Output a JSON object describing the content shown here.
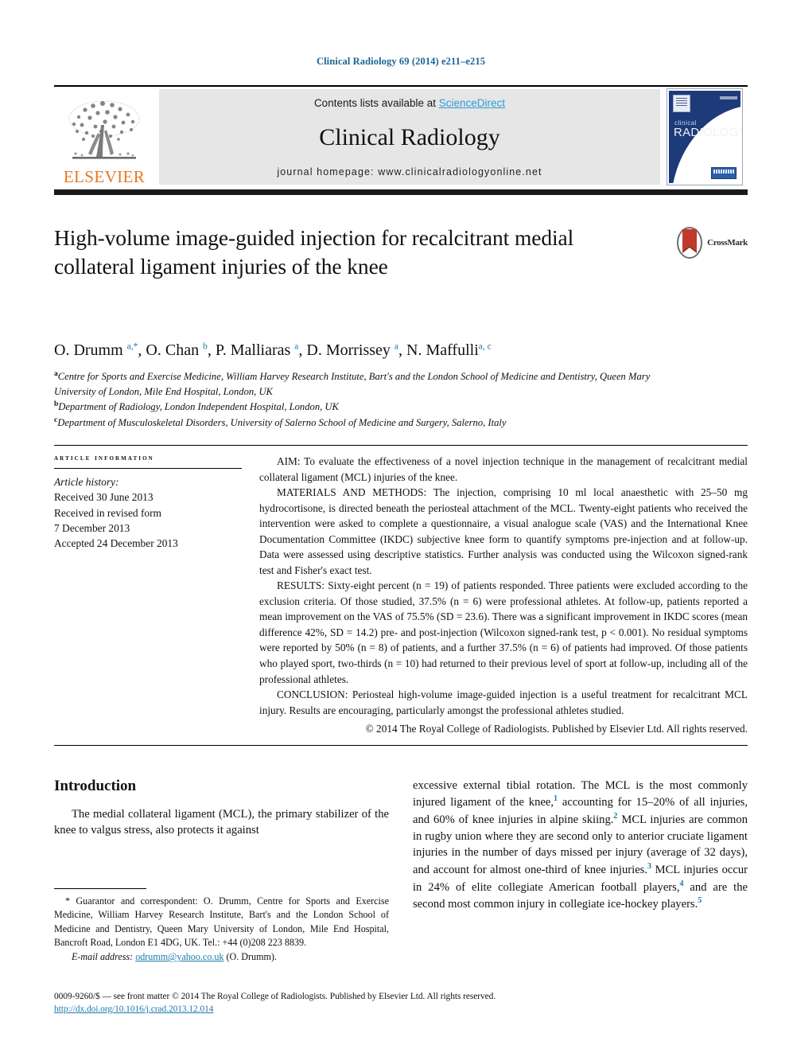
{
  "running_head": "Clinical Radiology 69 (2014) e211–e215",
  "masthead": {
    "publisher_logo_alt": "Elsevier",
    "publisher_wordmark": "ELSEVIER",
    "contents_prefix": "Contents lists available at ",
    "contents_link": "ScienceDirect",
    "journal_name": "Clinical Radiology",
    "homepage_line": "journal homepage: www.clinicalradiologyonline.net",
    "cover": {
      "line1": "clinical",
      "line2": "RADIOLOGY"
    }
  },
  "crossmark": {
    "label": "CrossMark"
  },
  "article": {
    "title": "High-volume image-guided injection for recalcitrant medial collateral ligament injuries of the knee",
    "authors_html": "O. Drumm <sup>a,*</sup>, O. Chan <sup>b</sup>, P. Malliaras <sup>a</sup>, D. Morrissey <sup>a</sup>, N. Maffulli<sup>a, c</sup>",
    "affiliations": [
      {
        "marker": "a",
        "text": "Centre for Sports and Exercise Medicine, William Harvey Research Institute, Bart's and the London School of Medicine and Dentistry, Queen Mary University of London, Mile End Hospital, London, UK"
      },
      {
        "marker": "b",
        "text": "Department of Radiology, London Independent Hospital, London, UK"
      },
      {
        "marker": "c",
        "text": "Department of Musculoskeletal Disorders, University of Salerno School of Medicine and Surgery, Salerno, Italy"
      }
    ]
  },
  "article_info": {
    "heading": "Article information",
    "history_label": "Article history:",
    "history_lines": [
      "Received 30 June 2013",
      "Received in revised form",
      "7 December 2013",
      "Accepted 24 December 2013"
    ]
  },
  "abstract": {
    "aim": "AIM: To evaluate the effectiveness of a novel injection technique in the management of recalcitrant medial collateral ligament (MCL) injuries of the knee.",
    "materials": "MATERIALS AND METHODS: The injection, comprising 10 ml local anaesthetic with 25–50 mg hydrocortisone, is directed beneath the periosteal attachment of the MCL. Twenty-eight patients who received the intervention were asked to complete a questionnaire, a visual analogue scale (VAS) and the International Knee Documentation Committee (IKDC) subjective knee form to quantify symptoms pre-injection and at follow-up. Data were assessed using descriptive statistics. Further analysis was conducted using the Wilcoxon signed-rank test and Fisher's exact test.",
    "results": "RESULTS: Sixty-eight percent (n = 19) of patients responded. Three patients were excluded according to the exclusion criteria. Of those studied, 37.5% (n = 6) were professional athletes. At follow-up, patients reported a mean improvement on the VAS of 75.5% (SD = 23.6). There was a significant improvement in IKDC scores (mean difference 42%, SD = 14.2) pre- and post-injection (Wilcoxon signed-rank test, p < 0.001). No residual symptoms were reported by 50% (n = 8) of patients, and a further 37.5% (n = 6) of patients had improved. Of those patients who played sport, two-thirds (n = 10) had returned to their previous level of sport at follow-up, including all of the professional athletes.",
    "conclusion": "CONCLUSION: Periosteal high-volume image-guided injection is a useful treatment for recalcitrant MCL injury. Results are encouraging, particularly amongst the professional athletes studied.",
    "copyright": "© 2014 The Royal College of Radiologists. Published by Elsevier Ltd. All rights reserved."
  },
  "introduction": {
    "heading": "Introduction",
    "left_paragraph": "The medial collateral ligament (MCL), the primary stabilizer of the knee to valgus stress, also protects it against",
    "right_paragraph_html": "excessive external tibial rotation. The MCL is the most commonly injured ligament of the knee,<sup>1</sup> accounting for 15–20% of all injuries, and 60% of knee injuries in alpine skiing.<sup>2</sup> MCL injuries are common in rugby union where they are second only to anterior cruciate ligament injuries in the number of days missed per injury (average of 32 days), and account for almost one-third of knee injuries.<sup>3</sup> MCL injuries occur in 24% of elite collegiate American football players,<sup>4</sup> and are the second most common injury in collegiate ice-hockey players.<sup>5</sup>"
  },
  "footnote": {
    "correspondence": "* Guarantor and correspondent: O. Drumm, Centre for Sports and Exercise Medicine, William Harvey Research Institute, Bart's and the London School of Medicine and Dentistry, Queen Mary University of London, Mile End Hospital, Bancroft Road, London E1 4DG, UK. Tel.: +44 (0)208 223 8839.",
    "email_label": "E-mail address:",
    "email_link": "odrumm@yahoo.co.uk",
    "email_suffix": "(O. Drumm)."
  },
  "page_footer": {
    "issn_line": "0009-9260/$ — see front matter © 2014 The Royal College of Radiologists. Published by Elsevier Ltd. All rights reserved.",
    "doi": "http://dx.doi.org/10.1016/j.crad.2013.12.014"
  },
  "colors": {
    "link_blue": "#1a7aab",
    "sciencedirect_blue": "#2e9bd6",
    "elsevier_orange": "#E87722",
    "masthead_grey": "#e6e6e6"
  }
}
